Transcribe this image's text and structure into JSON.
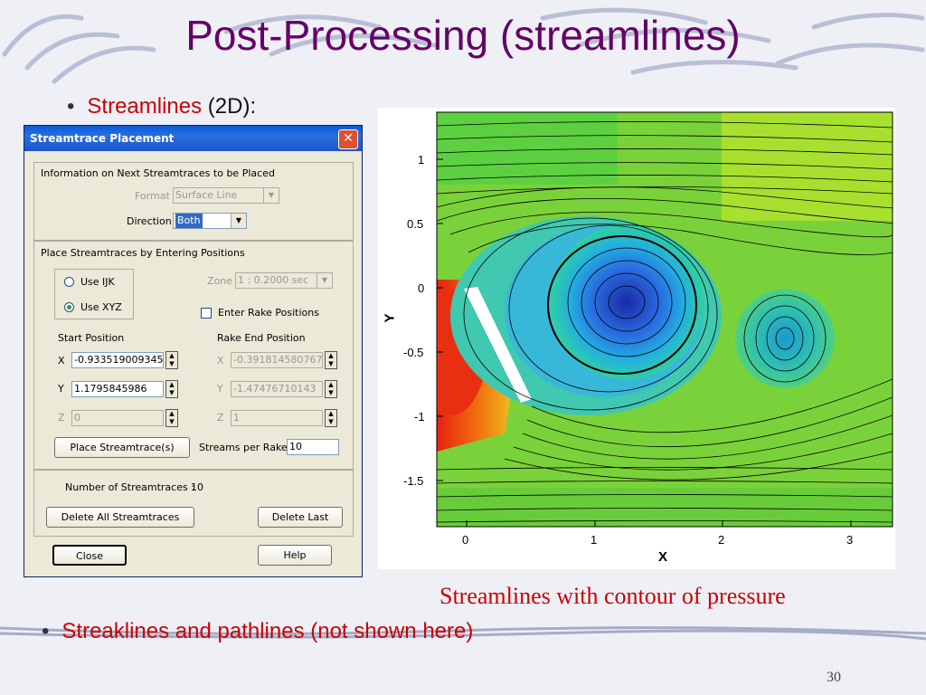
{
  "slide": {
    "title": "Post-Processing (streamlines)",
    "bullet1_red": "Streamlines",
    "bullet1_rest": " (2D):",
    "bullet2": "Streaklines and pathlines (not shown here)",
    "caption": "Streamlines with contour of pressure",
    "page_number": "30"
  },
  "dialog": {
    "title": "Streamtrace Placement",
    "info_header": "Information on Next Streamtraces to be Placed",
    "format_label": "Format",
    "format_value": "Surface Line",
    "direction_label": "Direction",
    "direction_value": "Both",
    "place_header": "Place Streamtraces by Entering Positions",
    "use_ijk": "Use IJK",
    "use_xyz": "Use XYZ",
    "zone_label": "Zone",
    "zone_value": "1 : 0.2000 sec",
    "enter_rake": "Enter Rake Positions",
    "start_position": "Start Position",
    "rake_end_position": "Rake End Position",
    "x_label": "X",
    "y_label": "Y",
    "z_label": "Z",
    "start_x": "-0.933519009345",
    "start_y": "1.1795845986",
    "start_z": "0",
    "end_x": "-0.391814580767",
    "end_y": "-1.47476710143",
    "end_z": "1",
    "place_button": "Place Streamtrace(s)",
    "streams_per_rake_label": "Streams per Rake",
    "streams_per_rake_value": "10",
    "num_streamtraces_label": "Number of Streamtraces :",
    "num_streamtraces_value": "10",
    "delete_all": "Delete All Streamtraces",
    "delete_last": "Delete Last",
    "close": "Close",
    "help": "Help",
    "close_icon": "close-icon"
  },
  "plot": {
    "xlabel": "X",
    "ylabel": "Y",
    "x_ticks": [
      "0",
      "1",
      "2",
      "3"
    ],
    "y_ticks": [
      "1",
      "0.5",
      "0",
      "-0.5",
      "-1",
      "-1.5"
    ]
  },
  "colors": {
    "title": "#660066",
    "red_text": "#cc0000",
    "titlebar": "#0a5ad8"
  }
}
